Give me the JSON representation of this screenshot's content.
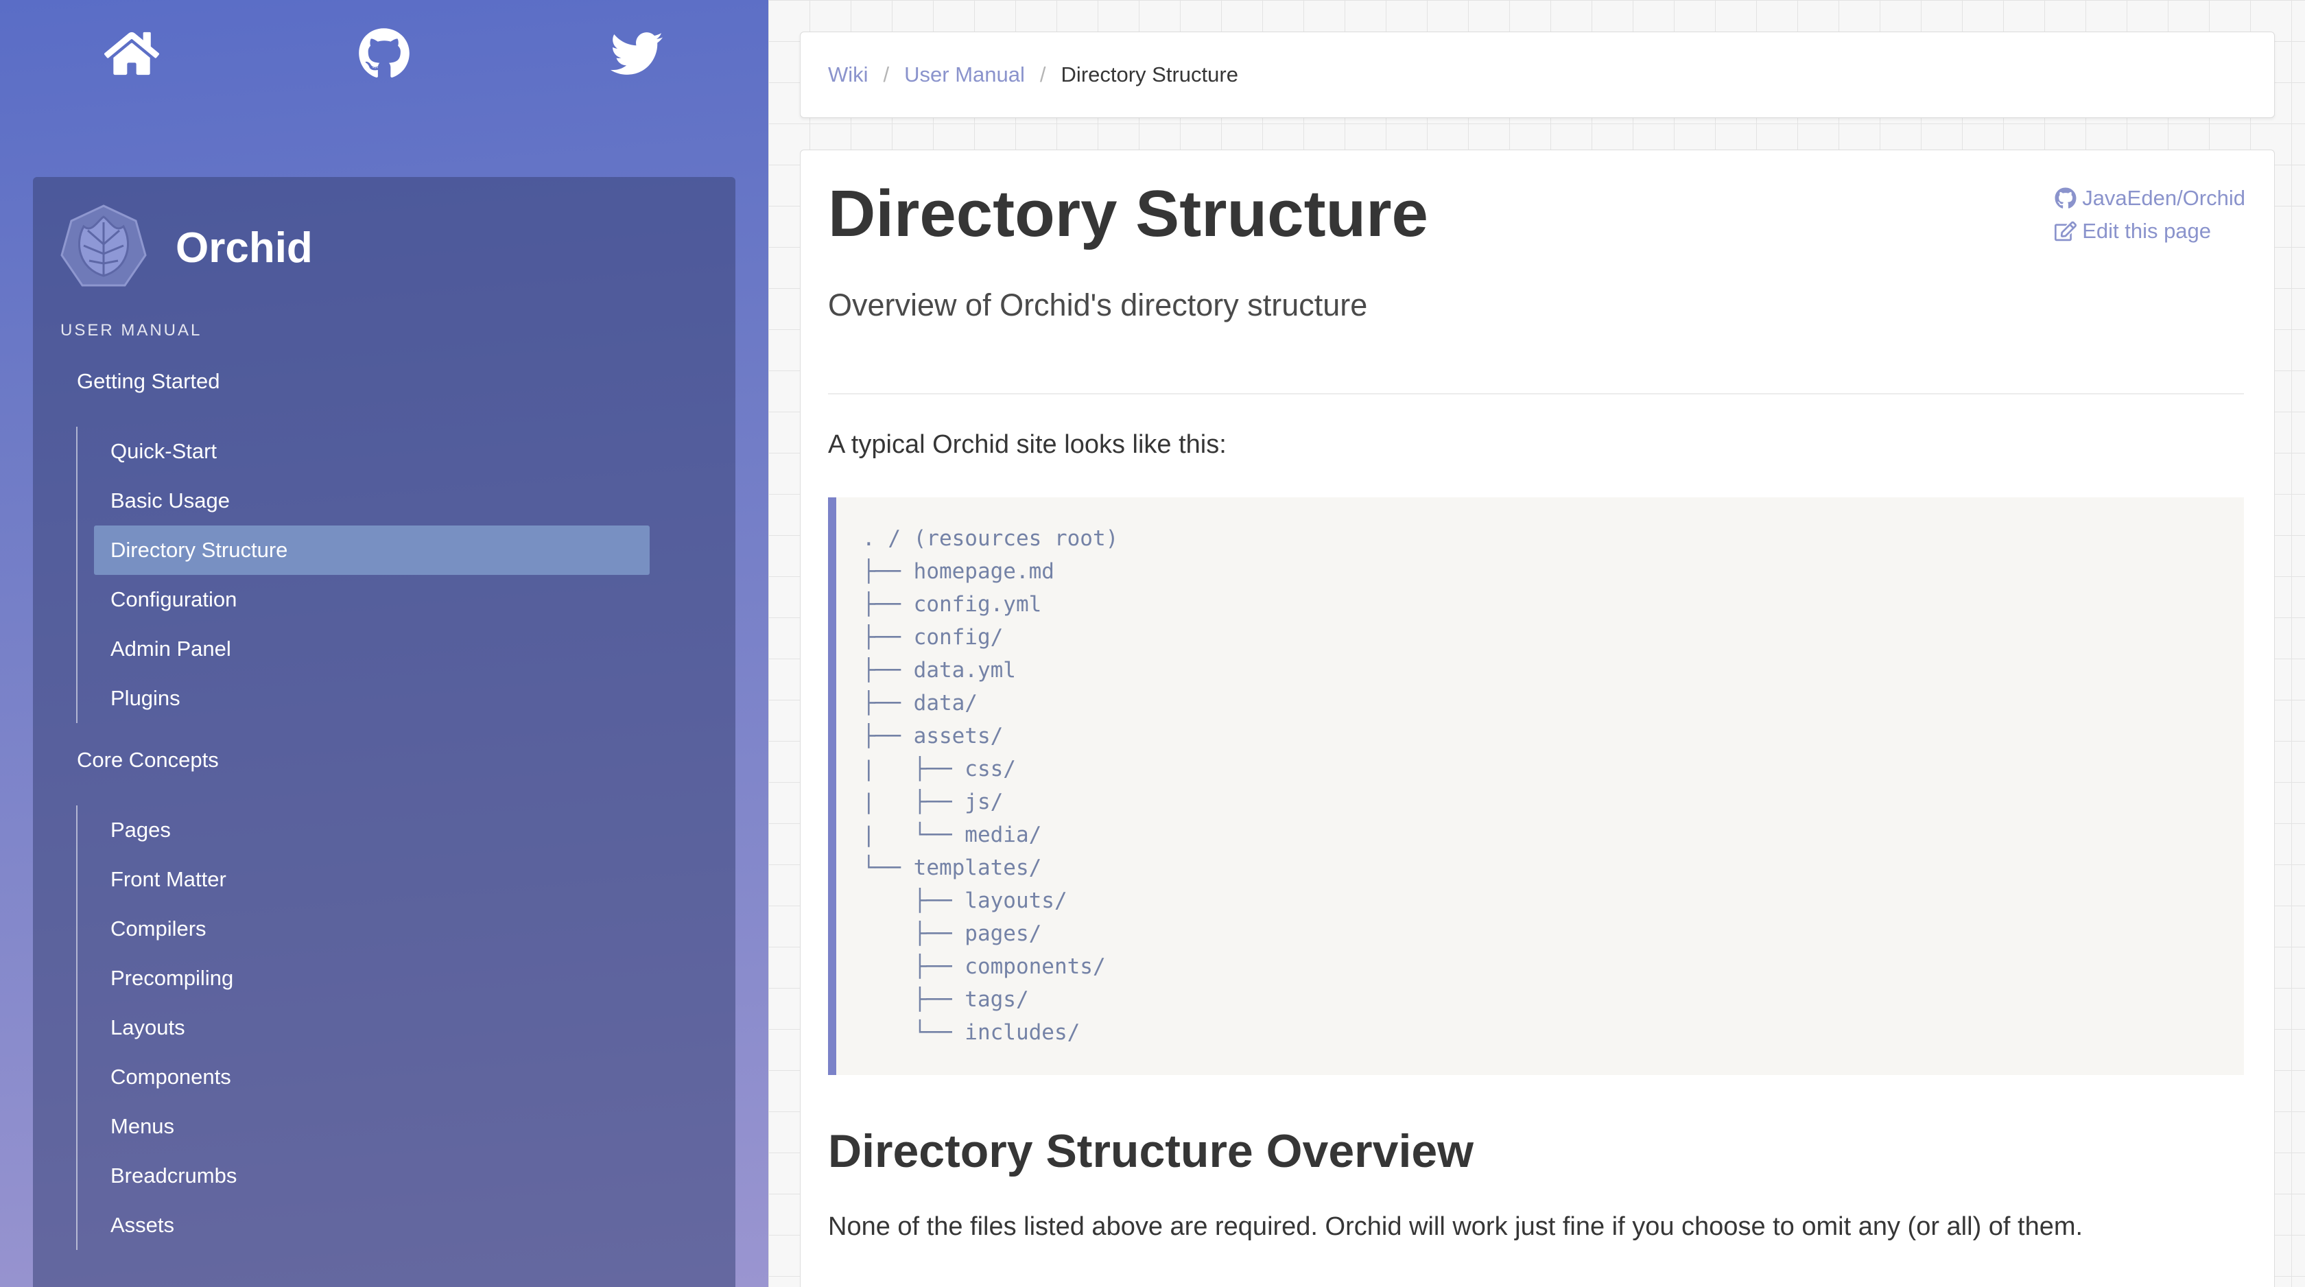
{
  "top_icons": [
    {
      "icon": "home-icon"
    },
    {
      "icon": "github-icon"
    },
    {
      "icon": "twitter-icon"
    }
  ],
  "brand": {
    "name": "Orchid",
    "logo_icon": "orchid-leaf-logo"
  },
  "sidebar": {
    "section_label": "USER MANUAL",
    "groups": [
      {
        "title": "Getting Started",
        "items": [
          "Quick-Start",
          "Basic Usage",
          "Directory Structure",
          "Configuration",
          "Admin Panel",
          "Plugins"
        ]
      },
      {
        "title": "Core Concepts",
        "items": [
          "Pages",
          "Front Matter",
          "Compilers",
          "Precompiling",
          "Layouts",
          "Components",
          "Menus",
          "Breadcrumbs",
          "Assets"
        ]
      }
    ],
    "active_item": "Directory Structure"
  },
  "breadcrumb": {
    "items": [
      "Wiki",
      "User Manual"
    ],
    "current": "Directory Structure",
    "separator": "/"
  },
  "page": {
    "title": "Directory Structure",
    "subtitle": "Overview of Orchid's directory structure",
    "repo_link": "JavaEden/Orchid",
    "edit_link": "Edit this page",
    "intro": "A typical Orchid site looks like this:",
    "code_lines": [
      ". / (resources root)",
      "├── homepage.md",
      "├── config.yml",
      "├── config/",
      "├── data.yml",
      "├── data/",
      "├── assets/",
      "|   ├── css/",
      "|   ├── js/",
      "|   └── media/",
      "└── templates/",
      "    ├── layouts/",
      "    ├── pages/",
      "    ├── components/",
      "    ├── tags/",
      "    └── includes/"
    ],
    "section_heading": "Directory Structure Overview",
    "section_body": "None of the files listed above are required. Orchid will work just fine if you choose to omit any (or all) of them."
  },
  "colors": {
    "sidebar_gradient_start": "#5a6dc6",
    "sidebar_gradient_end": "#9a95d0",
    "accent": "#8a93cc",
    "code_border": "#7b82c8",
    "text_dark": "#363636"
  }
}
